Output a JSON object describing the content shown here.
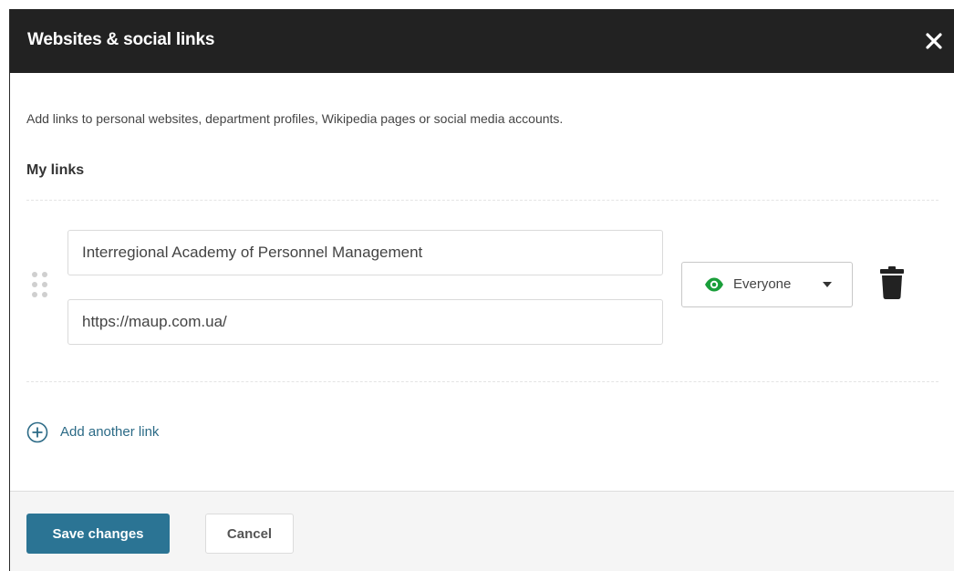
{
  "dialog": {
    "title": "Websites & social links",
    "close_icon": "close-icon",
    "intro": "Add links to personal websites, department profiles, Wikipedia pages or social media accounts.",
    "section_title": "My links"
  },
  "links": [
    {
      "title_value": "Interregional Academy of Personnel Management",
      "url_value": "https://maup.com.ua/",
      "visibility": {
        "label": "Everyone",
        "icon": "eye-icon",
        "icon_color": "#1a9e3a"
      },
      "delete_icon": "trash-icon",
      "drag_icon": "drag-handle-icon"
    }
  ],
  "add_link": {
    "label": "Add another link",
    "icon": "plus-circle-icon",
    "color": "#2b6a86"
  },
  "footer": {
    "save_label": "Save changes",
    "cancel_label": "Cancel",
    "save_color": "#2b7494"
  }
}
